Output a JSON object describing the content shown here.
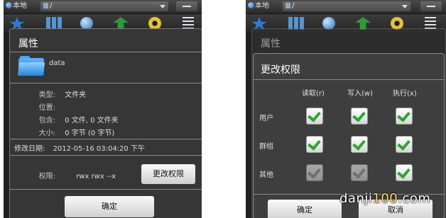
{
  "topbar": {
    "location_label": "本地",
    "path": "/"
  },
  "properties_dialog": {
    "title": "属性",
    "file_name": "data",
    "rows": [
      {
        "label": "类型:",
        "value": "文件夹"
      },
      {
        "label": "位置:",
        "value": ""
      },
      {
        "label": "包含:",
        "value": "0 文件, 0 文件夹"
      },
      {
        "label": "大小:",
        "value": "0 字节 (0 字节)"
      }
    ],
    "modified": {
      "label": "修改日期:",
      "value": "2012-05-16 03:04:20 下午"
    },
    "permissions": {
      "label": "权限:",
      "value": "rwx rwx --x"
    },
    "change_button": "更改权限",
    "ok_button": "确定"
  },
  "permission_dialog": {
    "title": "更改权限",
    "columns": [
      "读取(r)",
      "写入(w)",
      "执行(x)"
    ],
    "rows": [
      {
        "label": "用户",
        "checks": [
          true,
          true,
          true
        ],
        "enabled": [
          true,
          true,
          true
        ]
      },
      {
        "label": "群组",
        "checks": [
          true,
          true,
          true
        ],
        "enabled": [
          true,
          true,
          true
        ]
      },
      {
        "label": "其他",
        "checks": [
          true,
          true,
          true
        ],
        "enabled": [
          false,
          false,
          true
        ]
      }
    ],
    "ok_button": "确定",
    "cancel_button": "取消"
  },
  "watermark": {
    "prefix": "danji",
    "number": "100",
    "suffix": ".com"
  }
}
